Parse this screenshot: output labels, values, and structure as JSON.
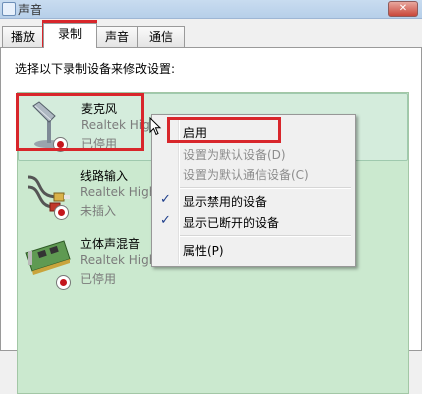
{
  "window": {
    "title": "声音",
    "close_glyph": "✕"
  },
  "tabs": [
    {
      "label": "播放"
    },
    {
      "label": "录制",
      "active": true
    },
    {
      "label": "声音"
    },
    {
      "label": "通信"
    }
  ],
  "instruction": "选择以下录制设备来修改设置:",
  "devices": [
    {
      "name": "麦克风",
      "driver": "Realtek High",
      "status": "已停用",
      "icon": "microphone-icon",
      "selected": true
    },
    {
      "name": "线路输入",
      "driver": "Realtek High",
      "status": "未插入",
      "icon": "line-in-cable-icon"
    },
    {
      "name": "立体声混音",
      "driver": "Realtek High",
      "status": "已停用",
      "icon": "sound-card-icon"
    }
  ],
  "context_menu": {
    "enable": "启用",
    "set_default": "设置为默认设备(D)",
    "set_default_comm": "设置为默认通信设备(C)",
    "show_disabled": "显示禁用的设备",
    "show_disconnected": "显示已断开的设备",
    "properties": "属性(P)",
    "check_glyph": "✓"
  },
  "colors": {
    "highlight": "#d8262b",
    "list_bg": "#cbe9cf",
    "disabled_text": "#7b7b7b"
  }
}
